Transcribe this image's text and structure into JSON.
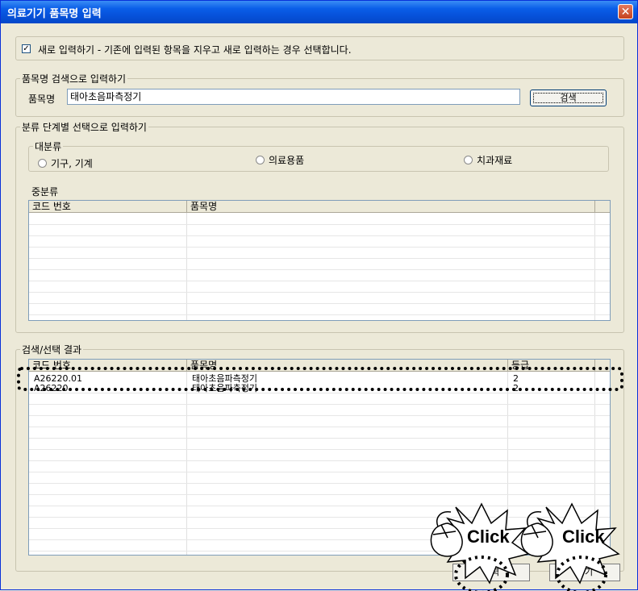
{
  "window": {
    "title": "의료기기 품목명 입력",
    "close_glyph": "✕"
  },
  "options": {
    "new_entry_label": "새로 입력하기 - 기존에 입력된 항목을 지우고 새로 입력하는 경우 선택합니다.",
    "new_entry_checked": true
  },
  "search": {
    "group_label": "품목명 검색으로 입력하기",
    "field_label": "품목명",
    "field_value": "태아초음파측정기",
    "button_label": "검색"
  },
  "category": {
    "group_label": "분류 단계별 선택으로 입력하기",
    "major_label": "대분류",
    "radios": [
      "기구, 기계",
      "의료용품",
      "치과재료"
    ],
    "middle_label": "중분류",
    "columns": [
      "코드 번호",
      "품목명"
    ]
  },
  "results": {
    "group_label": "검색/선택 결과",
    "columns": [
      "코드 번호",
      "품목명",
      "등급"
    ],
    "rows": [
      {
        "code": "A26220.01",
        "name": "태아초음파측정기",
        "grade": "2"
      },
      {
        "code": "A26220",
        "name": "태아초음파측정기",
        "grade": "2"
      }
    ]
  },
  "annotations": {
    "click_label": "Click"
  },
  "buttons": {
    "input_label": "입력",
    "close_label": "닫기"
  }
}
